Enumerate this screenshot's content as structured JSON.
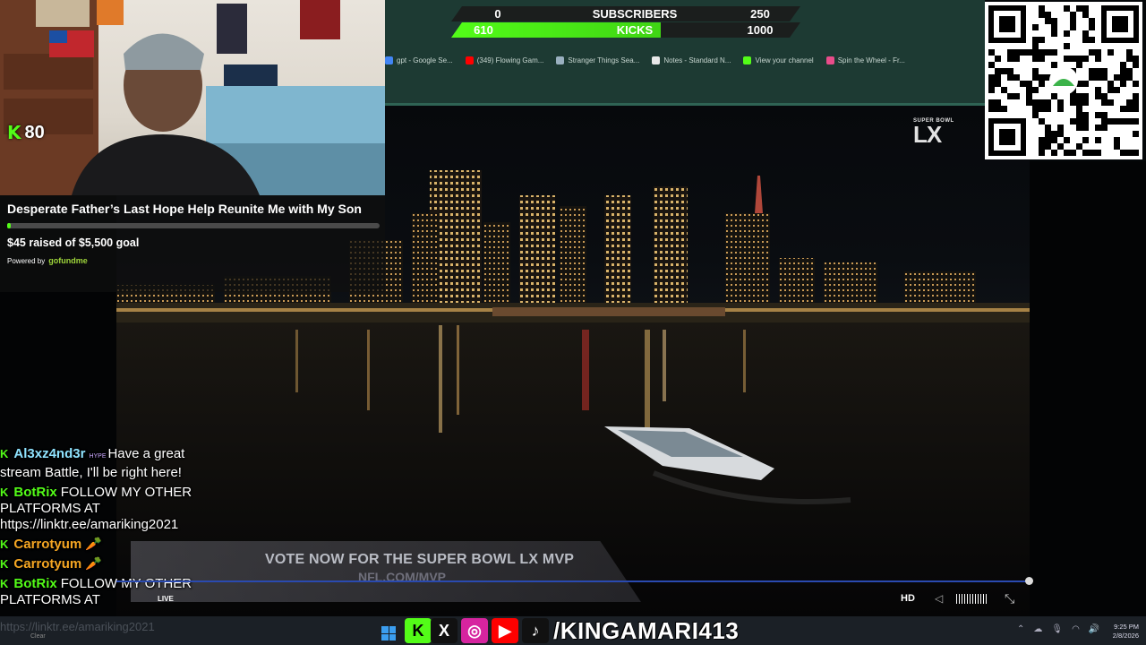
{
  "browser": {
    "bookmarks": [
      {
        "label": "gpt - Google Se...",
        "icon": "google-icon",
        "color": "#4285f4"
      },
      {
        "label": "(349) Flowing Gam...",
        "icon": "youtube-icon",
        "color": "#ff0000"
      },
      {
        "label": "Stranger Things Sea...",
        "icon": "site-icon",
        "color": "#9ab0c0"
      },
      {
        "label": "Notes - Standard N...",
        "icon": "notes-icon",
        "color": "#e8e8e8"
      },
      {
        "label": "View your channel",
        "icon": "kick-icon",
        "color": "#53fc18"
      },
      {
        "label": "Spin the Wheel - Fr...",
        "icon": "wheel-icon",
        "color": "#e94c8a"
      }
    ]
  },
  "goal_bars": {
    "subscribers": {
      "current": "0",
      "label": "SUBSCRIBERS",
      "goal": "250"
    },
    "kicks": {
      "current": "610",
      "label": "KICKS",
      "goal": "1000",
      "progress": 0.61
    }
  },
  "webcam": {
    "kick_logo": "K",
    "viewer_count": "80"
  },
  "gofundme": {
    "title": "Desperate Father’s Last Hope Help Reunite Me with My Son",
    "raised": "$45 raised of $5,500 goal",
    "progress": 0.008,
    "powered_by": "Powered by",
    "brand": "gofundme"
  },
  "chat": [
    {
      "user": "Al3xz4nd3r",
      "user_color": "#8fe3ff",
      "badge": "HYPE",
      "text": "Have a great stream Battle, I'll be right here!"
    },
    {
      "user": "BotRix",
      "user_color": "#53fc18",
      "badge": "",
      "text": "FOLLOW MY OTHER PLATFORMS AT https://linktr.ee/amariking2021"
    },
    {
      "user": "Carrotyum",
      "user_color": "#f5a623",
      "badge": "",
      "text": "🥕"
    },
    {
      "user": "Carrotyum",
      "user_color": "#f5a623",
      "badge": "",
      "text": "🥕"
    },
    {
      "user": "BotRix",
      "user_color": "#53fc18",
      "badge": "",
      "text": "FOLLOW MY OTHER PLATFORMS AT"
    }
  ],
  "chat_fade": "https://linktr.ee/amariking2021",
  "broadcast": {
    "logo_small": "SUPER BOWL",
    "logo_big": "LX",
    "vote_title": "VOTE NOW FOR THE SUPER BOWL LX MVP",
    "vote_url": "NFL.COM/MVP",
    "live": "LIVE"
  },
  "player": {
    "quality": "HD",
    "progress": 1.0
  },
  "taskbar": {
    "clear_label": "Clear",
    "handle": "/KINGAMARI413",
    "time": "9:25 PM",
    "date": "2/8/2026",
    "socials": [
      {
        "name": "kick",
        "glyph": "K",
        "color": "#53fc18",
        "text_color": "#000"
      },
      {
        "name": "x",
        "glyph": "X",
        "color": "#111111",
        "text_color": "#fff"
      },
      {
        "name": "instagram",
        "glyph": "◎",
        "color": "#d6249f",
        "text_color": "#fff"
      },
      {
        "name": "youtube",
        "glyph": "▶",
        "color": "#ff0000",
        "text_color": "#fff"
      },
      {
        "name": "tiktok",
        "glyph": "♪",
        "color": "#111111",
        "text_color": "#fff"
      }
    ],
    "tiktok_label": "TikTok"
  }
}
